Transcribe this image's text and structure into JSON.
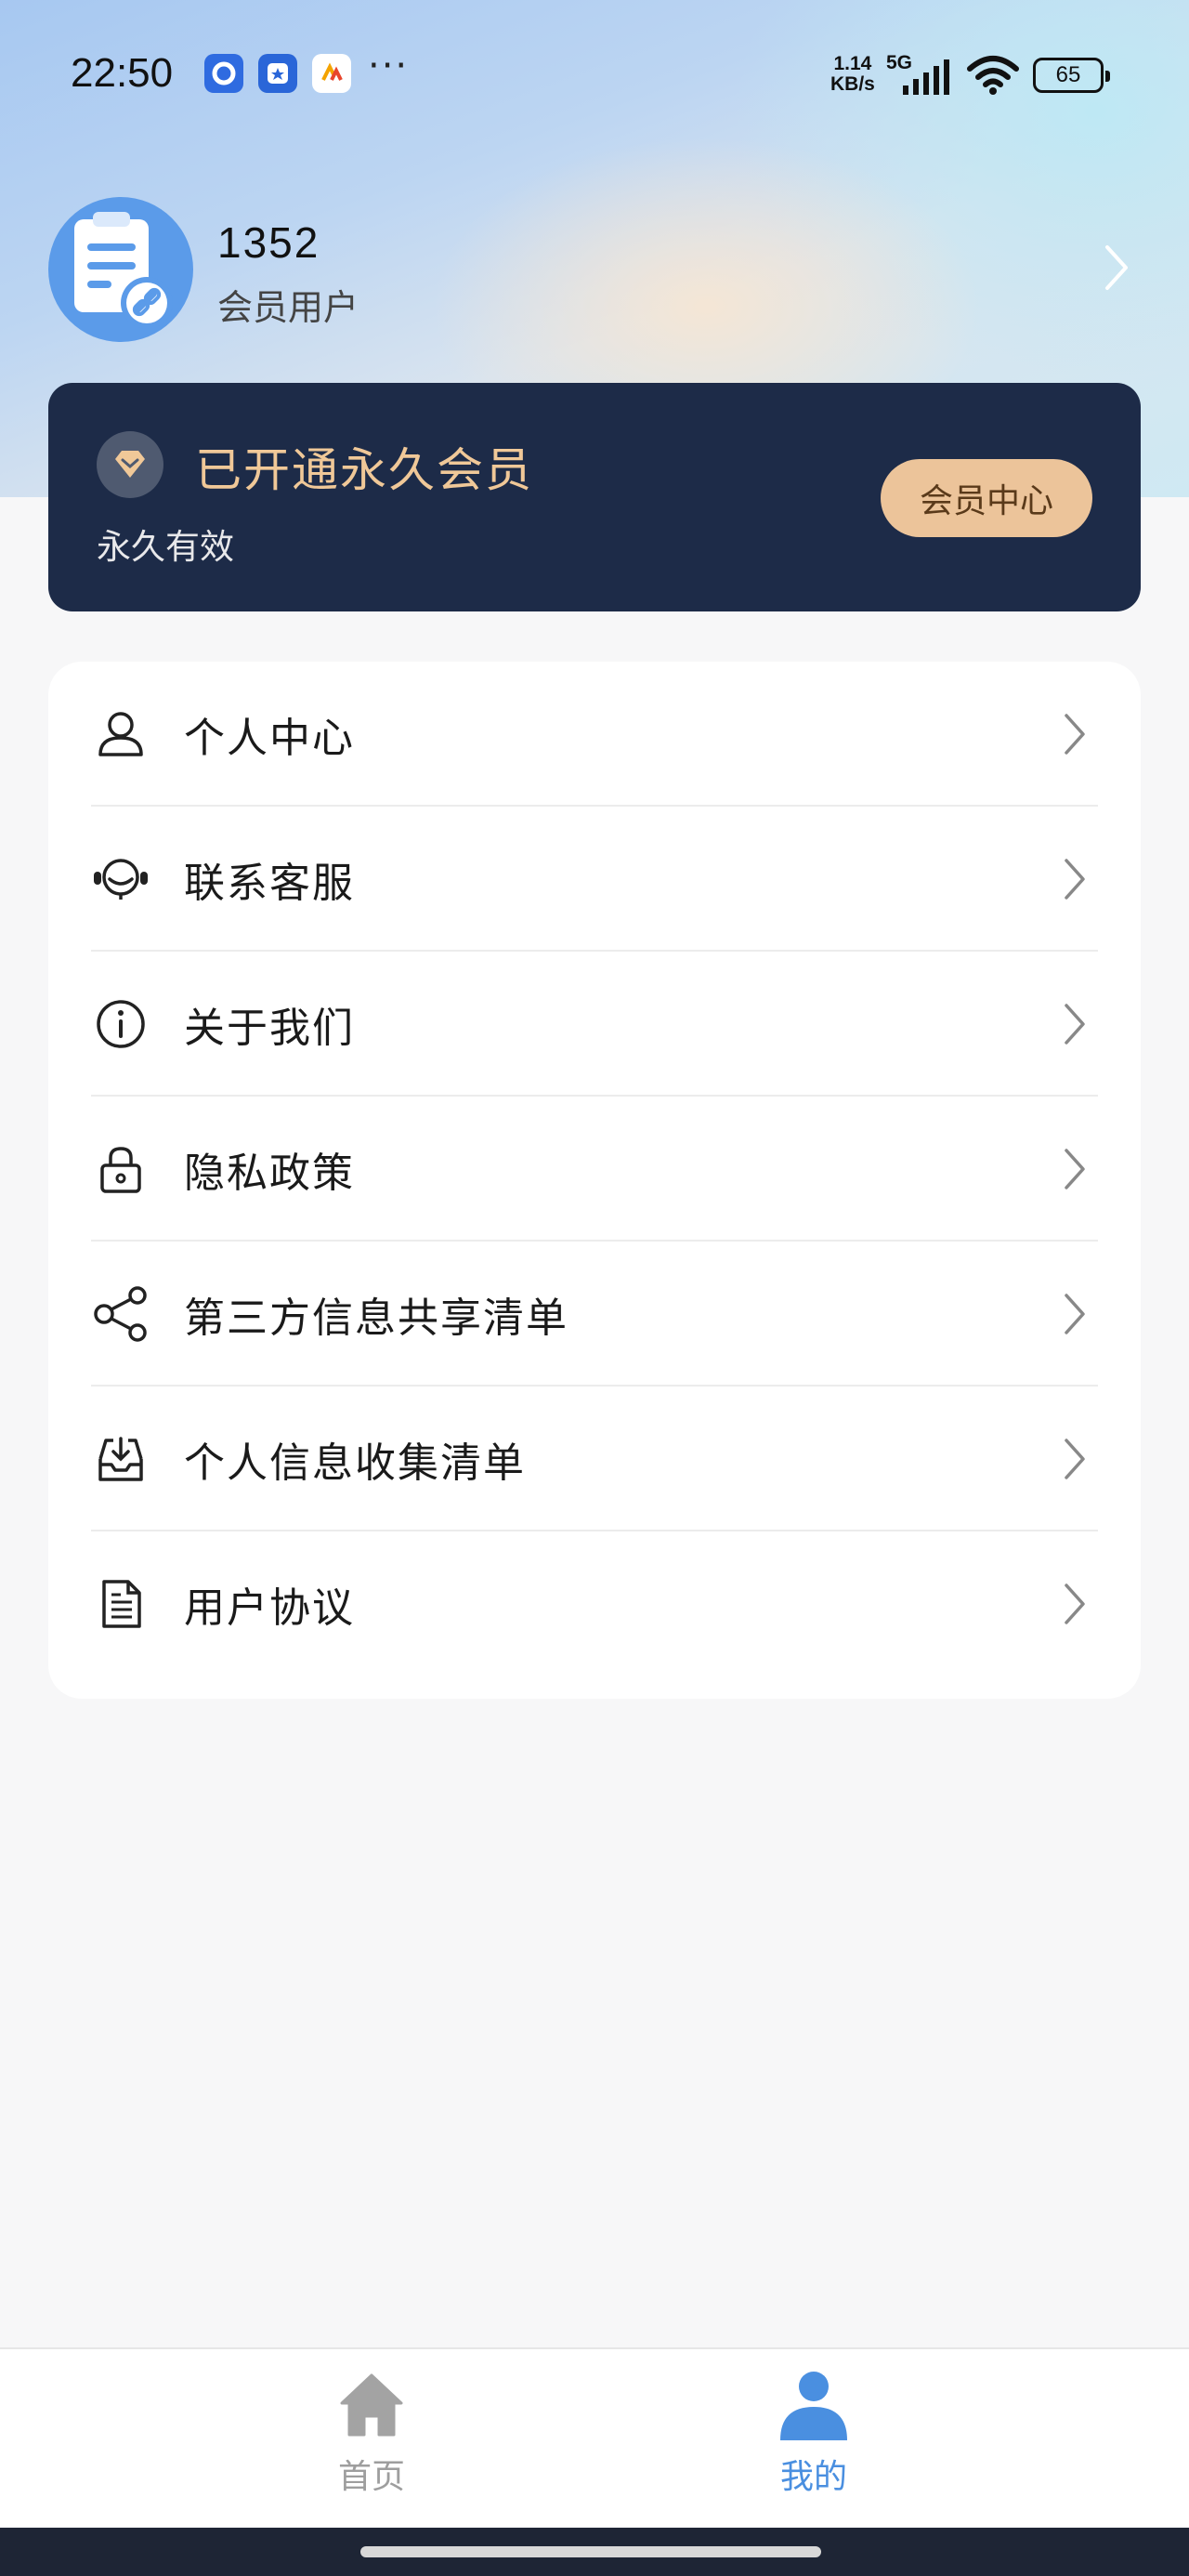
{
  "status_bar": {
    "time": "22:50",
    "notification_icons": [
      "qq-browser-icon",
      "star-app-icon",
      "maps-app-icon"
    ],
    "more": "···",
    "net_speed_value": "1.14",
    "net_speed_unit": "KB/s",
    "network_type": "5G",
    "battery_level": "65"
  },
  "profile": {
    "username": "1352",
    "subtitle": "会员用户"
  },
  "vip": {
    "title": "已开通永久会员",
    "validity": "永久有效",
    "button_label": "会员中心",
    "accent_color": "#f0c898",
    "card_color": "#1d2b48"
  },
  "menu": {
    "items": [
      {
        "label": "个人中心",
        "icon": "person-icon"
      },
      {
        "label": "联系客服",
        "icon": "headset-icon"
      },
      {
        "label": "关于我们",
        "icon": "info-icon"
      },
      {
        "label": "隐私政策",
        "icon": "lock-icon"
      },
      {
        "label": "第三方信息共享清单",
        "icon": "share-icon"
      },
      {
        "label": "个人信息收集清单",
        "icon": "inbox-download-icon"
      },
      {
        "label": "用户协议",
        "icon": "document-icon"
      }
    ]
  },
  "bottom_nav": {
    "tabs": [
      {
        "label": "首页",
        "icon": "home-icon",
        "active": false
      },
      {
        "label": "我的",
        "icon": "user-icon",
        "active": true
      }
    ],
    "active_color": "#4a8fe0",
    "inactive_color": "#9e9e9e"
  }
}
